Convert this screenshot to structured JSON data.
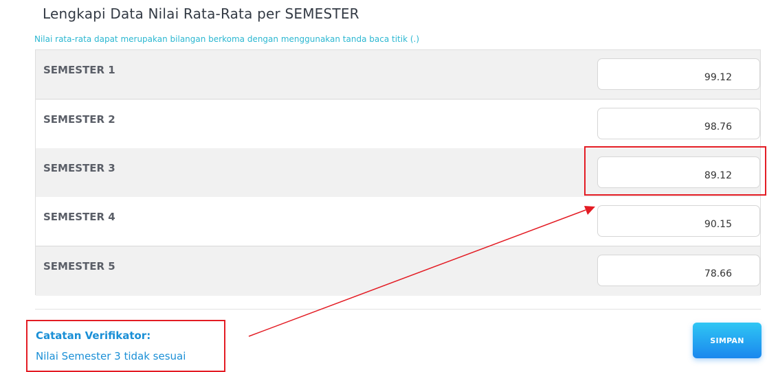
{
  "header": {
    "title": "Lengkapi Data Nilai Rata-Rata per SEMESTER",
    "subtitle": "Nilai rata-rata dapat merupakan bilangan berkoma dengan menggunakan tanda baca titik (.)"
  },
  "semesters": [
    {
      "label": "SEMESTER 1",
      "value": "99.12"
    },
    {
      "label": "SEMESTER 2",
      "value": "98.76"
    },
    {
      "label": "SEMESTER 3",
      "value": "89.12"
    },
    {
      "label": "SEMESTER 4",
      "value": "90.15"
    },
    {
      "label": "SEMESTER 5",
      "value": "78.66"
    }
  ],
  "note": {
    "title": "Catatan Verifikator:",
    "text": "Nilai Semester 3 tidak sesuai"
  },
  "actions": {
    "save_label": "SIMPAN"
  },
  "colors": {
    "accent": "#2bb7d1",
    "note": "#1a8fd6",
    "annotation_red": "#e31b23"
  }
}
